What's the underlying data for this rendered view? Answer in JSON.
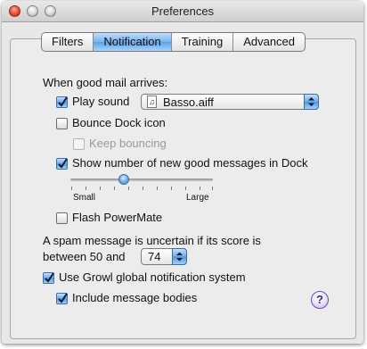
{
  "window": {
    "title": "Preferences"
  },
  "tabs": [
    {
      "label": "Filters"
    },
    {
      "label": "Notification",
      "active": true
    },
    {
      "label": "Training"
    },
    {
      "label": "Advanced"
    }
  ],
  "good_mail": {
    "heading": "When good mail arrives:",
    "play_sound": {
      "label": "Play sound",
      "checked": true
    },
    "sound_popup": {
      "value": "Basso.aiff",
      "icon": "music-note-file-icon"
    },
    "bounce_dock": {
      "label": "Bounce Dock icon",
      "checked": false
    },
    "keep_bouncing": {
      "label": "Keep bouncing",
      "checked": false,
      "enabled": false
    },
    "show_number": {
      "label": "Show number of new good messages in Dock",
      "checked": true
    },
    "size_slider": {
      "min_label": "Small",
      "max_label": "Large",
      "value_fraction": 0.35
    },
    "flash_powermate": {
      "label": "Flash PowerMate",
      "checked": false
    }
  },
  "spam": {
    "line1": "A spam message is uncertain if its score is",
    "line2": "between 50 and",
    "threshold": "74"
  },
  "growl": {
    "use_growl": {
      "label": "Use Growl global notification system",
      "checked": true
    },
    "include_bodies": {
      "label": "Include message bodies",
      "checked": true
    }
  },
  "help": {
    "label": "?"
  },
  "colors": {
    "accent": "#5ea1e6",
    "help_border": "#6a55b0"
  }
}
